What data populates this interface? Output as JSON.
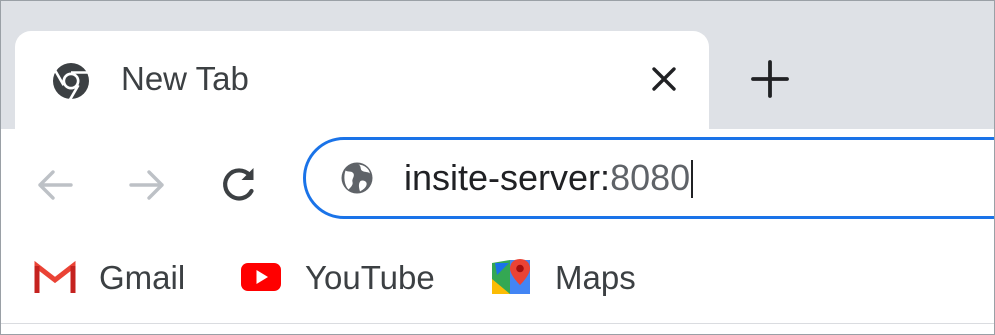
{
  "browser": {
    "tab": {
      "title": "New Tab",
      "favicon": "chrome-logo-icon",
      "close_icon": "close-icon"
    },
    "new_tab_icon": "plus-icon"
  },
  "toolbar": {
    "back_icon": "arrow-left-icon",
    "forward_icon": "arrow-right-icon",
    "reload_icon": "reload-icon",
    "omnibox": {
      "site_icon": "globe-icon",
      "host": "insite-server:",
      "port": "8080",
      "focused": true
    }
  },
  "bookmarks": [
    {
      "label": "Gmail",
      "icon": "gmail-icon"
    },
    {
      "label": "YouTube",
      "icon": "youtube-icon"
    },
    {
      "label": "Maps",
      "icon": "maps-icon"
    }
  ],
  "colors": {
    "accent": "#1a73e8",
    "tabstrip": "#dee1e6",
    "gmail_red": "#ea4335",
    "youtube_red": "#ff0000"
  }
}
